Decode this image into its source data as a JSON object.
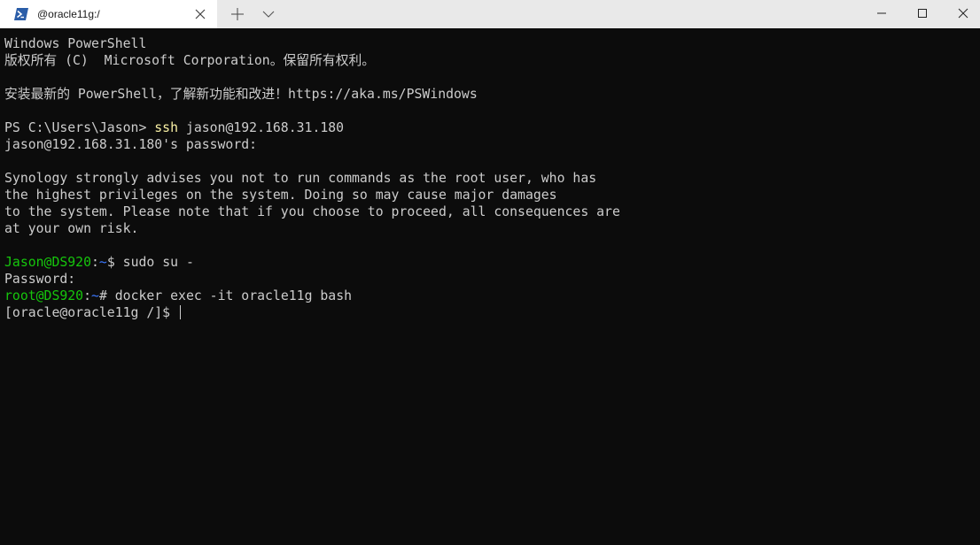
{
  "tab": {
    "title": "@oracle11g:/",
    "icon": "powershell-icon",
    "close_icon": "close-icon"
  },
  "toolbar": {
    "new_tab_icon": "plus-icon",
    "dropdown_icon": "chevron-down-icon"
  },
  "window_controls": {
    "minimize_icon": "minimize-icon",
    "maximize_icon": "maximize-icon",
    "close_icon": "close-icon"
  },
  "colors": {
    "terminal_bg": "#0c0c0c",
    "terminal_fg": "#cccccc",
    "command_yellow": "#f9f1a5",
    "prompt_green": "#16c60c",
    "prompt_blue": "#3b78ff",
    "titlebar_bg": "#e9e9e9",
    "tab_bg": "#ffffff"
  },
  "terminal": {
    "header_line1": "Windows PowerShell",
    "header_line2": "版权所有 (C)  Microsoft Corporation。保留所有权利。",
    "header_line3": "安装最新的 PowerShell，了解新功能和改进！https://aka.ms/PSWindows",
    "ps_prompt": "PS C:\\Users\\Jason> ",
    "ps_cmd": "ssh",
    "ps_args": " jason@192.168.31.180",
    "password_prompt": "jason@192.168.31.180's password:",
    "warning1": "Synology strongly advises you not to run commands as the root user, who has",
    "warning2": "the highest privileges on the system. Doing so may cause major damages",
    "warning3": "to the system. Please note that if you choose to proceed, all consequences are",
    "warning4": "at your own risk.",
    "user_prompt_user": "Jason@DS920",
    "user_prompt_sep": ":",
    "user_prompt_path": "~",
    "user_prompt_sym": "$ ",
    "user_cmd": "sudo su -",
    "sudo_password": "Password:",
    "root_prompt_user": "root@DS920",
    "root_prompt_sep": ":",
    "root_prompt_path": "~",
    "root_prompt_sym": "# ",
    "root_cmd": "docker exec -it oracle11g bash",
    "container_prompt": "[oracle@oracle11g /]$ "
  }
}
